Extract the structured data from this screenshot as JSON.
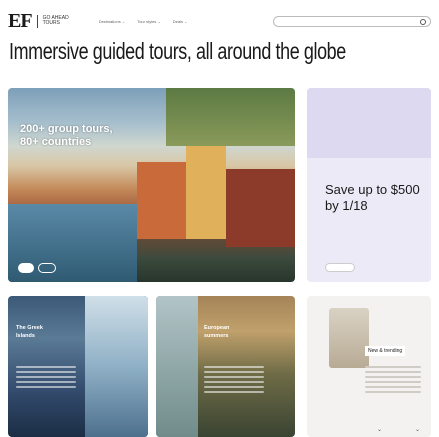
{
  "header": {
    "logo_mark": "EF",
    "logo_text_line1": "GO AHEAD",
    "logo_text_line2": "TOURS",
    "nav": [
      {
        "label": "Destinations"
      },
      {
        "label": "Tour styles"
      },
      {
        "label": "Deals"
      }
    ]
  },
  "hero": {
    "title": "Immersive guided tours, all around the globe"
  },
  "banner": {
    "headline_line1": "200+ group tours,",
    "headline_line2": "80+ countries"
  },
  "sale": {
    "headline": "Save up to $500 by 1/18"
  },
  "cards": [
    {
      "title_line1": "The Greek",
      "title_line2": "Islands"
    },
    {
      "title_line1": "European",
      "title_line2": "summers"
    },
    {
      "tag": "New & trending"
    }
  ]
}
